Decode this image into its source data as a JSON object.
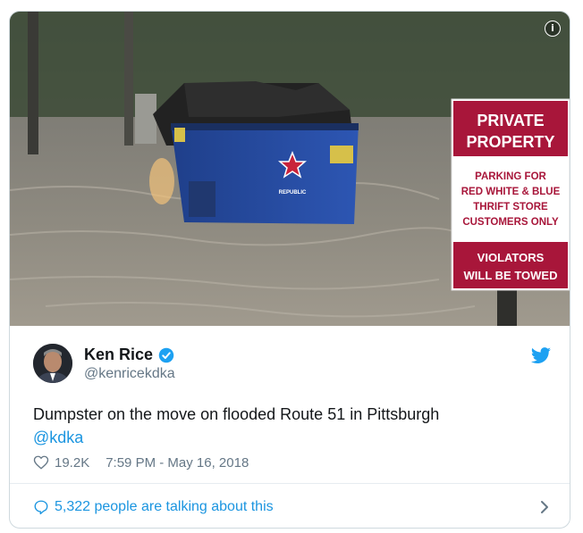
{
  "media": {
    "sign_title_1": "PRIVATE",
    "sign_title_2": "PROPERTY",
    "sign_body_1": "PARKING FOR",
    "sign_body_2": "RED WHITE & BLUE",
    "sign_body_3": "THRIFT STORE",
    "sign_body_4": "CUSTOMERS ONLY",
    "sign_footer_1": "VIOLATORS",
    "sign_footer_2": "WILL BE TOWED",
    "dumpster_label": "REPUBLIC"
  },
  "tweet": {
    "author_name": "Ken Rice",
    "author_handle": "@kenricekdka",
    "text": "Dumpster on the move on flooded Route 51 in Pittsburgh",
    "mention": "@kdka",
    "likes": "19.2K",
    "timestamp": "7:59 PM - May 16, 2018",
    "conversation": "5,322 people are talking about this"
  },
  "colors": {
    "link": "#1b95e0",
    "text": "#14171a",
    "muted": "#657786"
  },
  "icons": {
    "info": "info-icon",
    "verified": "verified-badge-icon",
    "brand": "twitter-bird-icon",
    "like": "heart-icon",
    "reply": "speech-bubble-icon",
    "more": "chevron-right-icon"
  }
}
